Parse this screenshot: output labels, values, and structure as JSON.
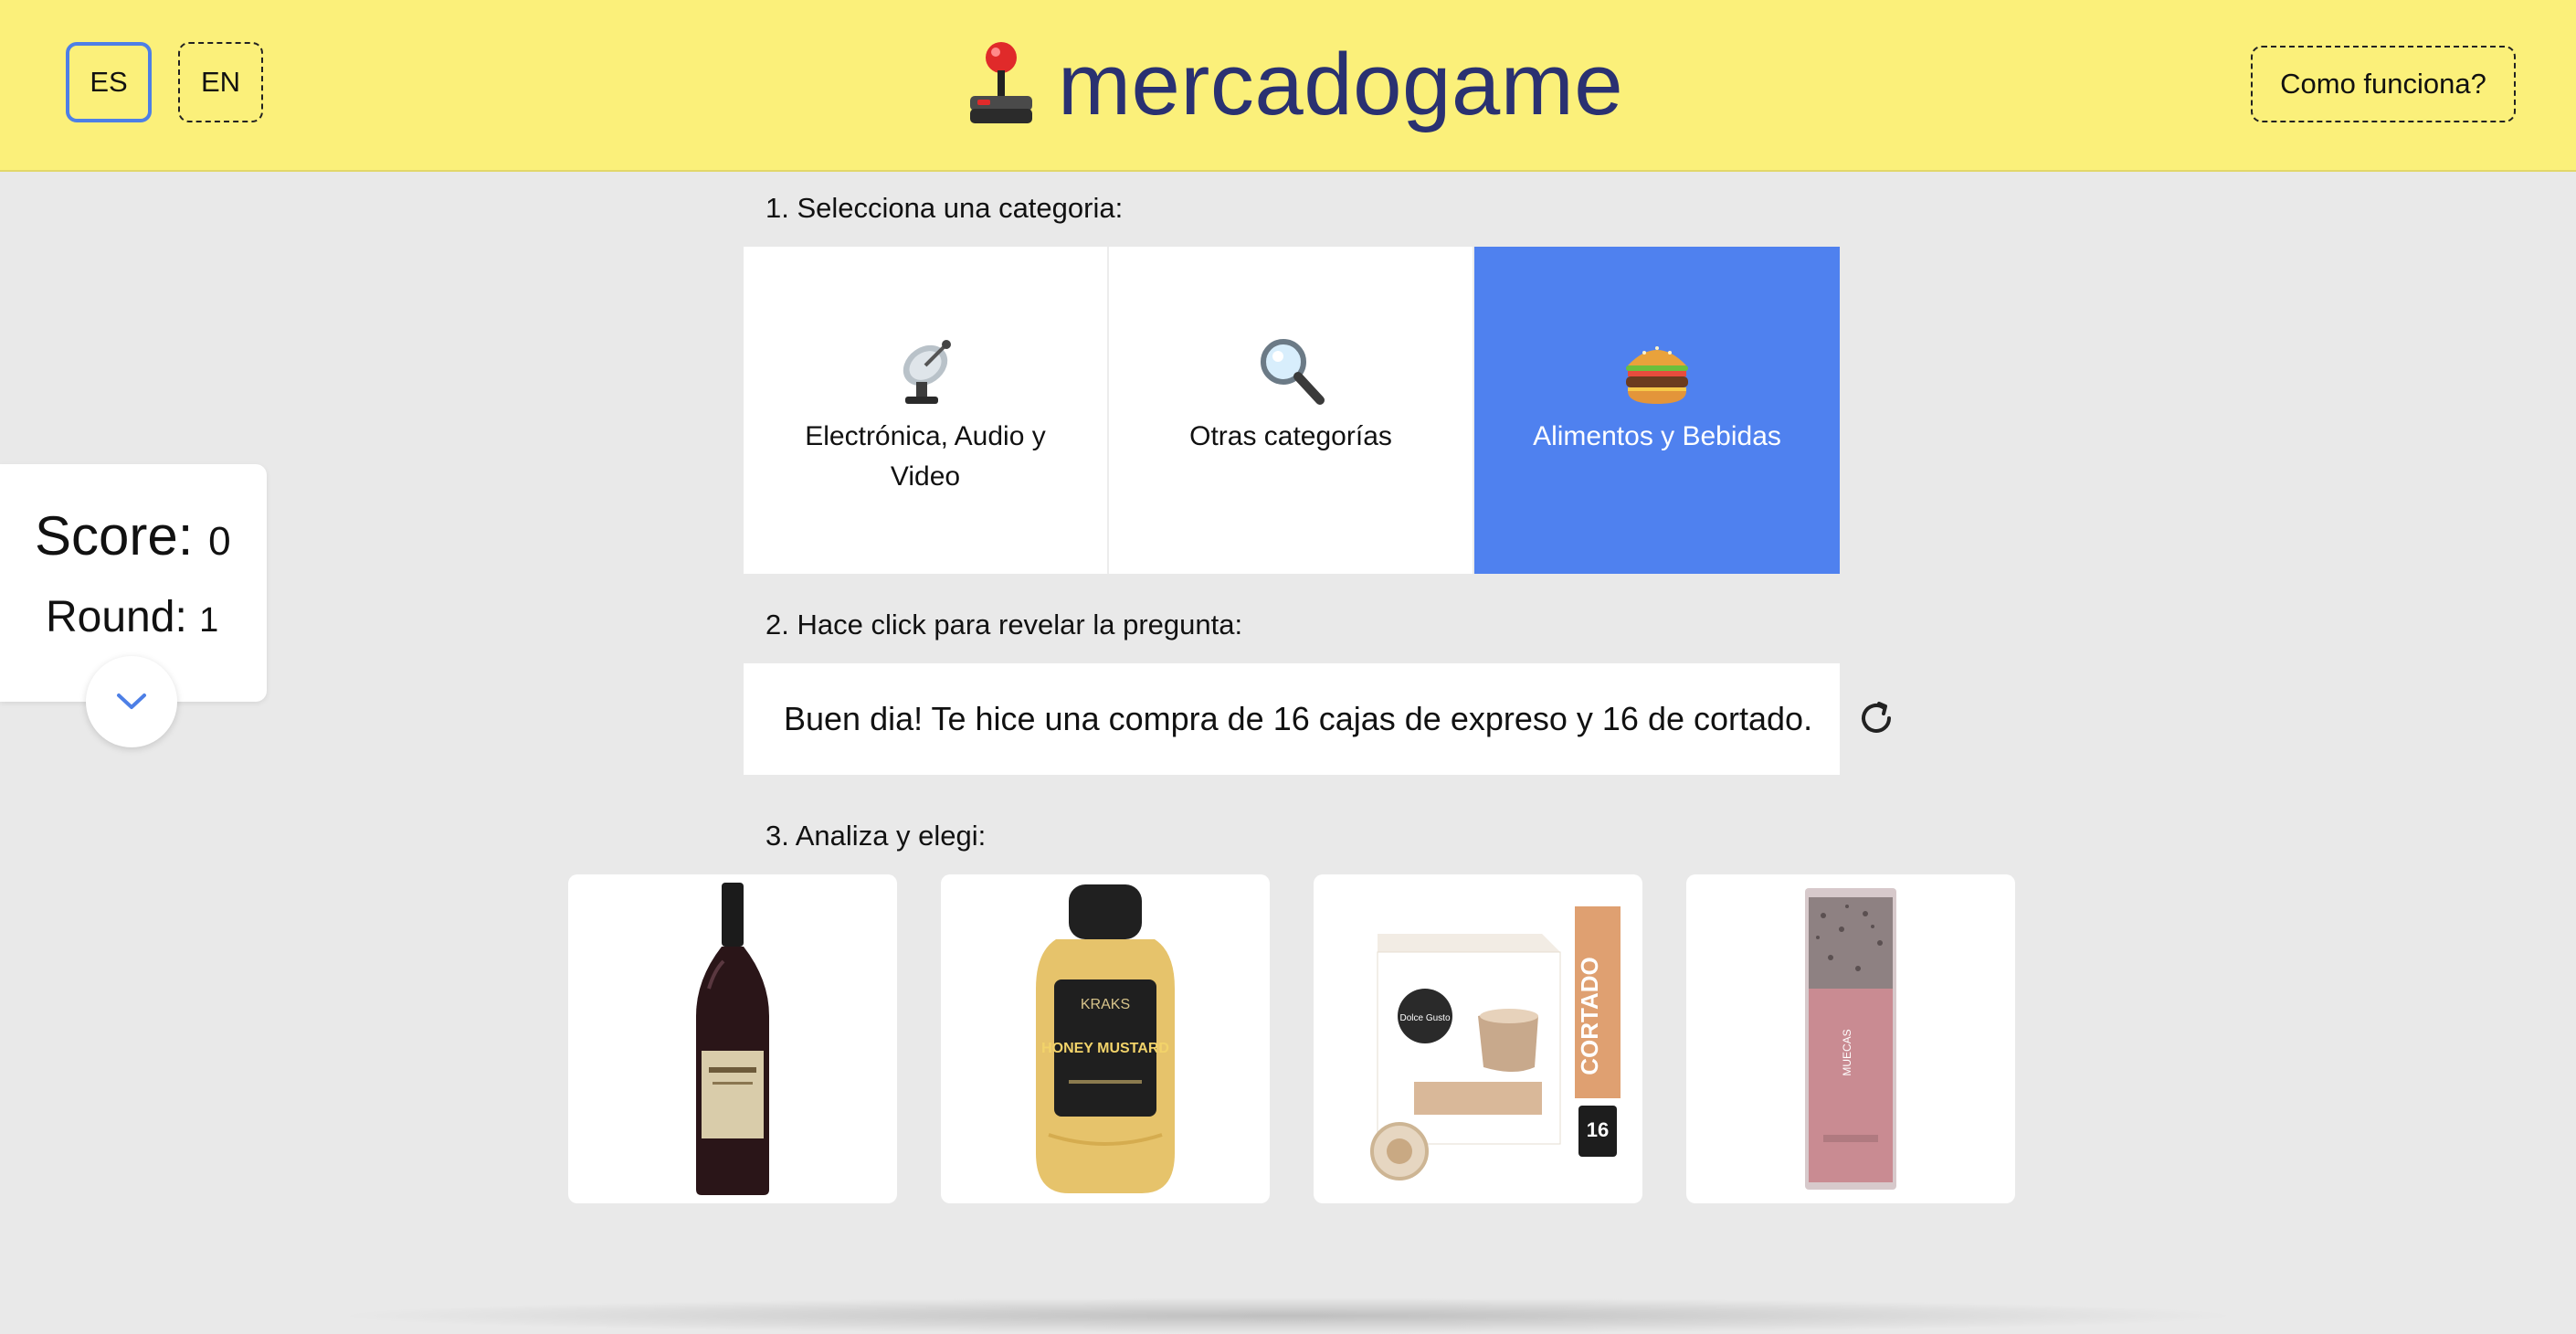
{
  "header": {
    "lang_es": "ES",
    "lang_en": "EN",
    "brand_title": "mercadogame",
    "brand_icon": "joystick-icon",
    "how_it_works": "Como funciona?"
  },
  "score": {
    "score_label": "Score:",
    "score_value": "0",
    "round_label": "Round:",
    "round_value": "1"
  },
  "steps": {
    "step1": "1. Selecciona una categoria:",
    "step2": "2. Hace click para revelar la pregunta:",
    "step3": "3. Analiza y elegi:"
  },
  "categories": [
    {
      "label": "Electrónica, Audio y Video",
      "icon": "satellite-dish-icon",
      "active": false
    },
    {
      "label": "Otras categorías",
      "icon": "magnifier-icon",
      "active": false
    },
    {
      "label": "Alimentos y Bebidas",
      "icon": "hamburger-icon",
      "active": true
    }
  ],
  "question": {
    "text": "Buen dia! Te hice una compra de 16 cajas de expreso y 16 de cortado."
  },
  "products": [
    {
      "name": "wine-bottle",
      "label": ""
    },
    {
      "name": "honey-mustard",
      "brand_text": "KRAKS",
      "label_text": "HONEY MUSTARD"
    },
    {
      "name": "dolce-gusto-cortado",
      "brand_text": "Dolce Gusto",
      "label_text": "CORTADO",
      "count": "16"
    },
    {
      "name": "cereal-bar",
      "brand_text": "MUECAS"
    }
  ],
  "colors": {
    "header_bg": "#fbf07a",
    "brand_text": "#2a3171",
    "accent_blue": "#4f81ef",
    "page_bg": "#e9e9e9"
  }
}
